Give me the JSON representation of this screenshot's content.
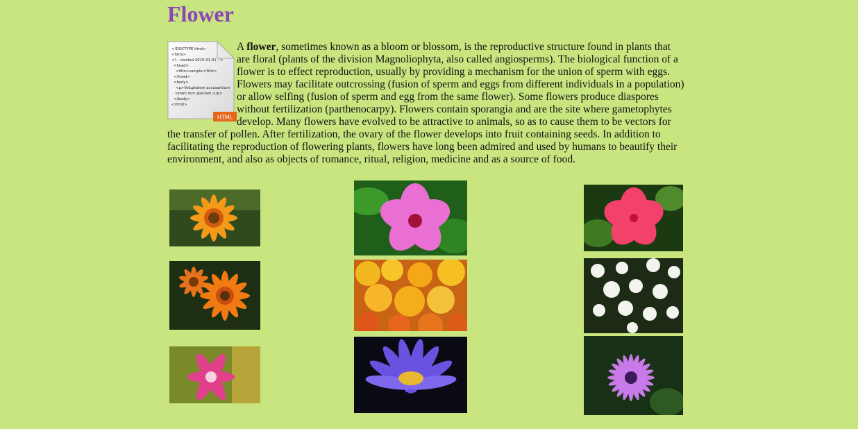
{
  "page": {
    "title": "Flower",
    "intro_lead": "A ",
    "intro_bold": "flower",
    "intro_rest": ", sometimes known as a bloom or blossom, is the reproductive structure found in plants that are floral (plants of the division Magnoliophyta, also called angiosperms). The biological function of a flower is to effect reproduction, usually by providing a mechanism for the union of sperm with eggs. Flowers may facilitate outcrossing (fusion of sperm and eggs from different individuals in a population) or allow selfing (fusion of sperm and egg from the same flower). Some flowers produce diaspores without fertilization (parthenocarpy). Flowers contain sporangia and are the site where gametophytes develop. Many flowers have evolved to be attractive to animals, so as to cause them to be vectors for the transfer of pollen. After fertilization, the ovary of the flower develops into fruit containing seeds. In addition to facilitating the reproduction of flowering plants, flowers have long been admired and used by humans to beautify their environment, and also as objects of romance, ritual, religion, medicine and as a source of food."
  },
  "doc_icon": {
    "lines": [
      "<!DOCTYPE html>",
      "<html>",
      "<!-- created 2010-01-01 -->",
      "<head>",
      "<title>sample</title>",
      "</head>",
      "<body>",
      "<p>Voluptatem accusantium",
      "totam rem aperiam.</p>",
      "</body>",
      "</html>"
    ],
    "badge": "HTML"
  },
  "colors": {
    "background": "#c8e580",
    "title": "#8b45b8"
  }
}
